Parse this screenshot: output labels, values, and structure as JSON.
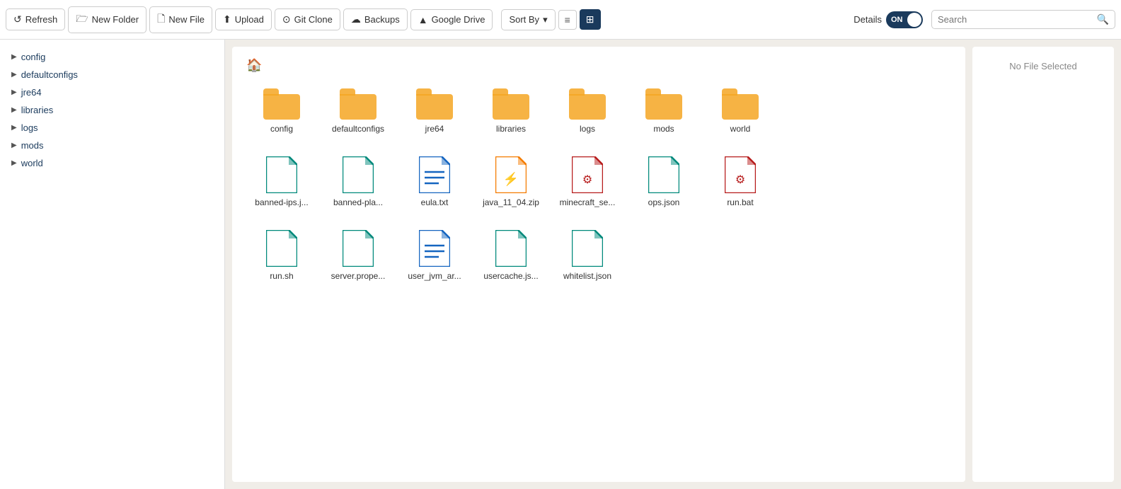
{
  "toolbar": {
    "refresh_label": "Refresh",
    "new_folder_label": "New Folder",
    "new_file_label": "New File",
    "upload_label": "Upload",
    "git_clone_label": "Git Clone",
    "backups_label": "Backups",
    "google_drive_label": "Google Drive",
    "sort_by_label": "Sort By",
    "details_label": "Details",
    "toggle_state": "ON",
    "search_placeholder": "Search"
  },
  "sidebar": {
    "items": [
      {
        "label": "config"
      },
      {
        "label": "defaultconfigs"
      },
      {
        "label": "jre64"
      },
      {
        "label": "libraries"
      },
      {
        "label": "logs"
      },
      {
        "label": "mods"
      },
      {
        "label": "world"
      }
    ]
  },
  "files": {
    "no_selection_text": "No File Selected",
    "folders": [
      {
        "label": "config"
      },
      {
        "label": "defaultconfigs"
      },
      {
        "label": "jre64"
      },
      {
        "label": "libraries"
      },
      {
        "label": "logs"
      },
      {
        "label": "mods"
      },
      {
        "label": "world"
      }
    ],
    "files_row2": [
      {
        "label": "banned-ips.j...",
        "color": "#00897B",
        "type": "plain"
      },
      {
        "label": "banned-pla...",
        "color": "#00897B",
        "type": "plain"
      },
      {
        "label": "eula.txt",
        "color": "#1565C0",
        "type": "lines"
      },
      {
        "label": "java_11_04.zip",
        "color": "#F57C00",
        "type": "zip"
      },
      {
        "label": "minecraft_se...",
        "color": "#B71C1C",
        "type": "gear"
      },
      {
        "label": "ops.json",
        "color": "#00897B",
        "type": "plain"
      },
      {
        "label": "run.bat",
        "color": "#B71C1C",
        "type": "gear"
      }
    ],
    "files_row3": [
      {
        "label": "run.sh",
        "color": "#00897B",
        "type": "plain"
      },
      {
        "label": "server.prope...",
        "color": "#00897B",
        "type": "plain"
      },
      {
        "label": "user_jvm_ar...",
        "color": "#1565C0",
        "type": "lines"
      },
      {
        "label": "usercache.js...",
        "color": "#00897B",
        "type": "plain"
      },
      {
        "label": "whitelist.json",
        "color": "#00897B",
        "type": "plain"
      }
    ]
  }
}
